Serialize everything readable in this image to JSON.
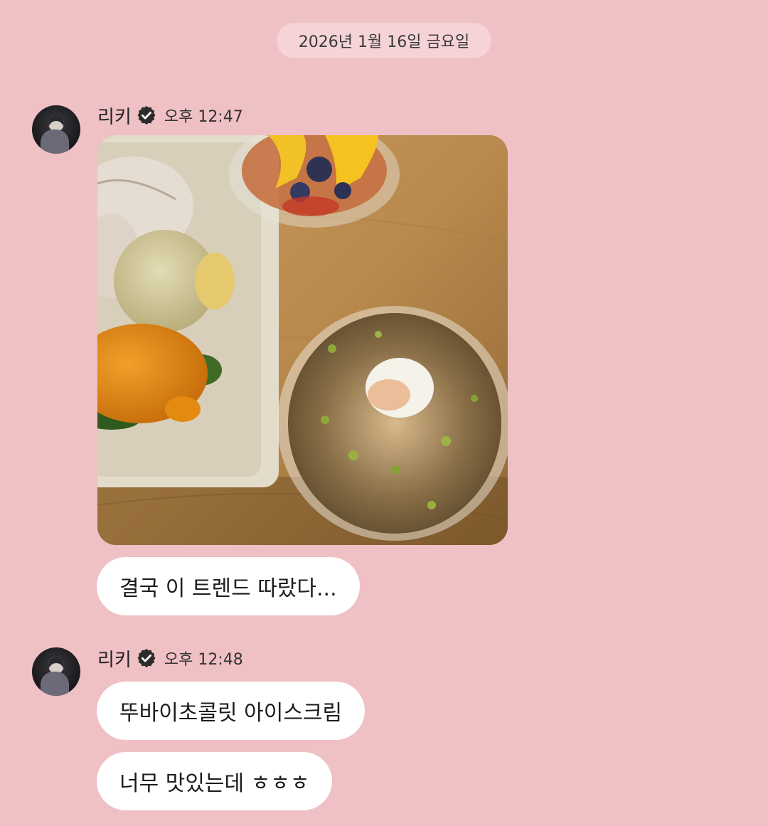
{
  "date_divider": "2026년 1월 16일 금요일",
  "messages": [
    {
      "sender": "리키",
      "time": "오후 12:47",
      "avatar_icon": "profile-photo",
      "verified_icon": "verified-badge-icon",
      "photo": "food-photo",
      "texts": [
        "결국 이 트렌드 따랐다..."
      ]
    },
    {
      "sender": "리키",
      "time": "오후 12:48",
      "avatar_icon": "profile-photo",
      "verified_icon": "verified-badge-icon",
      "texts": [
        "뚜바이초콜릿 아이스크림",
        "너무 맛있는데 ㅎㅎㅎ"
      ]
    }
  ],
  "colors": {
    "background": "#efc0c4",
    "date_chip": "#f5d3d6",
    "bubble": "#ffffff",
    "verified_badge": "#2b2b2b"
  }
}
